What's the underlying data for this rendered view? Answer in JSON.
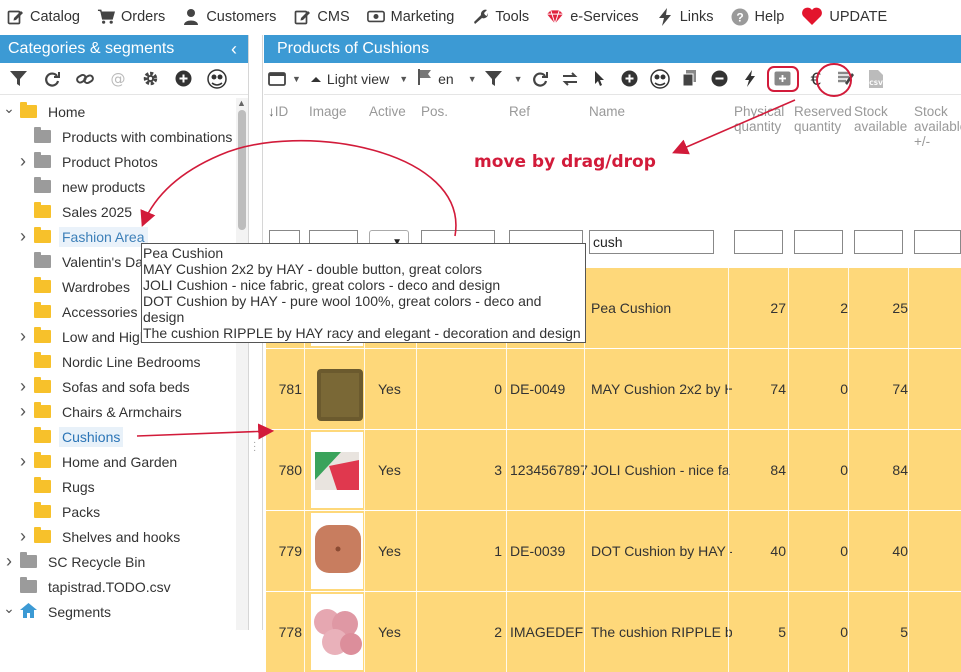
{
  "topmenu": [
    {
      "label": "Catalog",
      "icon": "pencil-square-icon"
    },
    {
      "label": "Orders",
      "icon": "cart-icon"
    },
    {
      "label": "Customers",
      "icon": "user-icon"
    },
    {
      "label": "CMS",
      "icon": "edit-icon"
    },
    {
      "label": "Marketing",
      "icon": "money-icon"
    },
    {
      "label": "Tools",
      "icon": "wrench-icon"
    },
    {
      "label": "e-Services",
      "icon": "gem-icon"
    },
    {
      "label": "Links",
      "icon": "bolt-icon"
    },
    {
      "label": "Help",
      "icon": "help-icon"
    },
    {
      "label": "UPDATE",
      "icon": "heart-icon"
    }
  ],
  "left_panel": {
    "title": "Categories & segments",
    "collapse": "‹",
    "tree": [
      {
        "label": "Home",
        "color": "yellow",
        "expanded": true,
        "depth": 0
      },
      {
        "label": "Products with combinations",
        "color": "grey",
        "depth": 1
      },
      {
        "label": "Product Photos",
        "color": "grey",
        "expandable": true,
        "depth": 1
      },
      {
        "label": "new products",
        "color": "grey",
        "depth": 1
      },
      {
        "label": "Sales 2025",
        "color": "yellow",
        "depth": 1
      },
      {
        "label": "Fashion Area",
        "color": "yellow",
        "expandable": true,
        "depth": 1,
        "state": "hl"
      },
      {
        "label": "Valentin's Day",
        "color": "grey",
        "depth": 1
      },
      {
        "label": "Wardrobes",
        "color": "yellow",
        "depth": 1
      },
      {
        "label": "Accessories f",
        "color": "yellow",
        "depth": 1
      },
      {
        "label": "Low and High Tables",
        "color": "yellow",
        "expandable": true,
        "depth": 1
      },
      {
        "label": "Nordic Line Bedrooms",
        "color": "yellow",
        "depth": 1
      },
      {
        "label": "Sofas and sofa beds",
        "color": "yellow",
        "expandable": true,
        "depth": 1
      },
      {
        "label": "Chairs & Armchairs",
        "color": "yellow",
        "expandable": true,
        "depth": 1
      },
      {
        "label": "Cushions",
        "color": "yellow",
        "depth": 1,
        "state": "sel"
      },
      {
        "label": "Home and Garden",
        "color": "yellow",
        "expandable": true,
        "depth": 1
      },
      {
        "label": "Rugs",
        "color": "yellow",
        "depth": 1
      },
      {
        "label": "Packs",
        "color": "yellow",
        "depth": 1
      },
      {
        "label": "Shelves and hooks",
        "color": "yellow",
        "expandable": true,
        "depth": 1
      },
      {
        "label": "SC Recycle Bin",
        "color": "grey",
        "expandable": true,
        "depth": 0
      },
      {
        "label": "tapistrad.TODO.csv",
        "color": "grey",
        "depth": 0
      },
      {
        "label": "Segments",
        "color": "blue",
        "expanded": true,
        "depth": 0
      }
    ]
  },
  "right_panel": {
    "title": "Products of Cushions",
    "toolbar": {
      "view": "Light view",
      "lang": "en"
    },
    "columns": [
      "ID",
      "Image",
      "Active",
      "Pos.",
      "Ref",
      "Name",
      "Physical quantity",
      "Reserved quantity",
      "Stock available",
      "Stock available +/-"
    ],
    "filters": {
      "name": "cush"
    },
    "rows": [
      {
        "id": "",
        "active": "",
        "pos": "",
        "ref": "",
        "name": "Pea Cushion",
        "phys": "27",
        "res": "2",
        "stock": "25"
      },
      {
        "id": "781",
        "active": "Yes",
        "pos": "0",
        "ref": "DE-0049",
        "name": "MAY Cushion 2x2 by H",
        "phys": "74",
        "res": "0",
        "stock": "74"
      },
      {
        "id": "780",
        "active": "Yes",
        "pos": "3",
        "ref": "1234567897",
        "name": "JOLI Cushion - nice fa",
        "phys": "84",
        "res": "0",
        "stock": "84"
      },
      {
        "id": "779",
        "active": "Yes",
        "pos": "1",
        "ref": "DE-0039",
        "name": "DOT Cushion by HAY -",
        "phys": "40",
        "res": "0",
        "stock": "40"
      },
      {
        "id": "778",
        "active": "Yes",
        "pos": "2",
        "ref": "IMAGEDEF",
        "name": "The cushion RIPPLE b",
        "phys": "5",
        "res": "0",
        "stock": "5"
      }
    ]
  },
  "tooltip": [
    "Pea Cushion",
    "MAY Cushion 2x2 by HAY - double button, great colors",
    "JOLI Cushion - nice fabric, great colors - deco and design",
    "DOT Cushion by HAY - pure wool 100%, great colors - deco and design",
    "The cushion RIPPLE by HAY racy and elegant - decoration and design"
  ],
  "annotation": {
    "text": "move by drag/drop",
    "color": "#d21b3a"
  },
  "colors": {
    "header": "#3c9ad4",
    "row": "#fed87a",
    "accent": "#d21b3a",
    "folder": "#f7c12b"
  }
}
